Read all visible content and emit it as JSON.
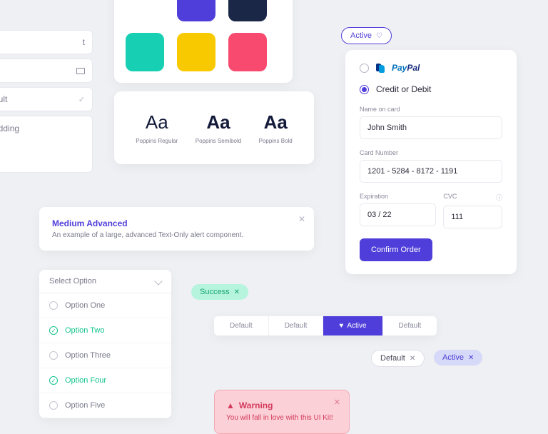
{
  "inputs": {
    "partial1": "t",
    "partial2": "ault",
    "partial3": "adding"
  },
  "colors": {
    "row1": [
      "#4f3ed9",
      "#1a2747"
    ],
    "row2": [
      "#17d0b4",
      "#f9c900",
      "#f84a6e"
    ]
  },
  "typography": {
    "samples": [
      {
        "aa": "Aa",
        "weight": 400,
        "label": "Poppins Regular"
      },
      {
        "aa": "Aa",
        "weight": 600,
        "label": "Poppins Semibold"
      },
      {
        "aa": "Aa",
        "weight": 700,
        "label": "Poppins Bold"
      }
    ]
  },
  "alert": {
    "title": "Medium Advanced",
    "desc": "An example of a large, advanced Text-Only alert component."
  },
  "select": {
    "head": "Select Option",
    "items": [
      {
        "label": "Option One",
        "selected": false
      },
      {
        "label": "Option Two",
        "selected": true
      },
      {
        "label": "Option Three",
        "selected": false
      },
      {
        "label": "Option Four",
        "selected": true
      },
      {
        "label": "Option Five",
        "selected": false
      }
    ]
  },
  "tags": {
    "active": "Active",
    "success": "Success",
    "default": "Default"
  },
  "segmented": {
    "items": [
      "Default",
      "Default",
      "Active",
      "Default"
    ],
    "activeIndex": 2
  },
  "warning": {
    "title": "Warning",
    "desc": "You will fall in love with this UI Kit!"
  },
  "payment": {
    "paypal": "PayPal",
    "credit_label": "Credit or Debit",
    "name_label": "Name on card",
    "name_value": "John Smith",
    "card_label": "Card Number",
    "card_value": "1201 - 5284 - 8172 - 1191",
    "exp_label": "Expiration",
    "exp_value": "03 / 22",
    "cvc_label": "CVC",
    "cvc_value": "111",
    "confirm": "Confirm Order"
  }
}
